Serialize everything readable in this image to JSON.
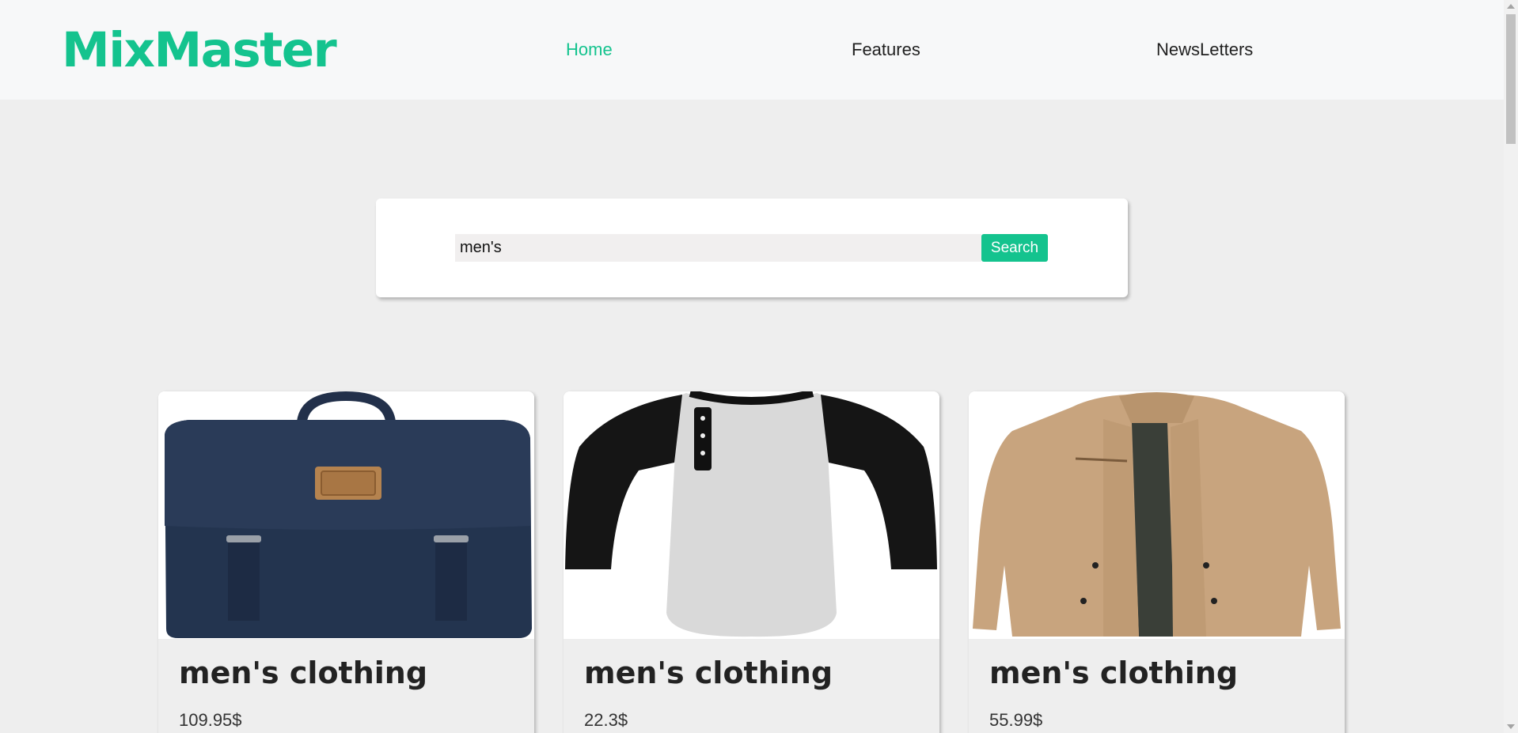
{
  "header": {
    "logo": "MixMaster",
    "nav": [
      {
        "label": "Home",
        "active": true
      },
      {
        "label": "Features",
        "active": false
      },
      {
        "label": "NewsLetters",
        "active": false
      }
    ]
  },
  "search": {
    "value": "men's",
    "placeholder": "",
    "button_label": "Search"
  },
  "products": [
    {
      "title": "men's clothing",
      "price": "109.95$",
      "image_icon": "backpack-icon"
    },
    {
      "title": "men's clothing",
      "price": "22.3$",
      "image_icon": "tshirt-icon"
    },
    {
      "title": "men's clothing",
      "price": "55.99$",
      "image_icon": "jacket-icon"
    }
  ],
  "colors": {
    "accent": "#14c38e",
    "background": "#eeeeee",
    "navbar": "#f7f8f9"
  }
}
